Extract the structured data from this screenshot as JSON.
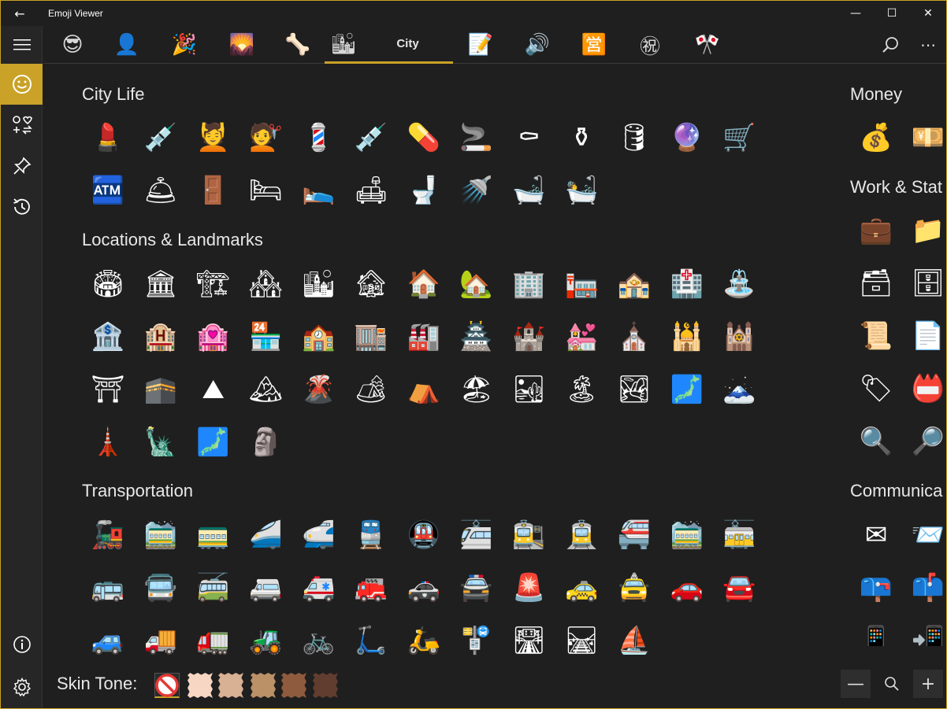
{
  "window": {
    "title": "Emoji Viewer",
    "back_glyph": "←",
    "minimize": "—",
    "maximize": "☐",
    "close": "✕"
  },
  "rail": {
    "menu_icon": "hamburger-icon",
    "items": [
      {
        "name": "smiley-icon",
        "glyph": "☺"
      },
      {
        "name": "symbols-icon",
        "glyph": "♡"
      },
      {
        "name": "pin-icon",
        "glyph": "📌"
      },
      {
        "name": "history-icon",
        "glyph": "⟲"
      }
    ],
    "info_glyph": "ⓘ",
    "settings_glyph": "⚙"
  },
  "categories": {
    "items": [
      "😎",
      "👤",
      "🎉",
      "🌄",
      "🦴",
      "🏙",
      "",
      "📝",
      "🔊",
      "🈺",
      "㊗",
      "🎌"
    ],
    "active_label": "City",
    "search_glyph": "⌕",
    "more_glyph": "⋯"
  },
  "sections": [
    {
      "title": "City Life",
      "emojis": [
        "💄",
        "💉",
        "💆",
        "💇",
        "💈",
        "💉",
        "💊",
        "🚬",
        "⚰",
        "⚱",
        "🛢",
        "🔮",
        "🛒",
        "🏧",
        "🛎",
        "🚪",
        "🛏",
        "🛌",
        "🛋",
        "🚽",
        "🚿",
        "🛁",
        "🛀"
      ]
    },
    {
      "title": "Locations & Landmarks",
      "emojis": [
        "🏟",
        "🏛",
        "🏗",
        "🏘",
        "🏙",
        "🏚",
        "🏠",
        "🏡",
        "🏢",
        "🏣",
        "🏤",
        "🏥",
        "⛲",
        "🏦",
        "🏨",
        "🏩",
        "🏪",
        "🏫",
        "🏬",
        "🏭",
        "🏯",
        "🏰",
        "💒",
        "⛪",
        "🕌",
        "🕍",
        "⛩",
        "🕋",
        "⛰",
        "🏔",
        "🌋",
        "🏕",
        "⛺",
        "🏖",
        "🏜",
        "🏝",
        "🏞",
        "🗾",
        "🗻",
        "🗼",
        "🗽",
        "🗾",
        "🗿"
      ]
    },
    {
      "title": "Transportation",
      "emojis": [
        "🚂",
        "🚞",
        "🚃",
        "🚄",
        "🚅",
        "🚆",
        "🚇",
        "🚈",
        "🚉",
        "🚊",
        "🚝",
        "🚞",
        "🚋",
        "🚌",
        "🚍",
        "🚎",
        "🚐",
        "🚑",
        "🚒",
        "🚓",
        "🚔",
        "🚨",
        "🚕",
        "🚖",
        "🚗",
        "🚘",
        "🚙",
        "🚚",
        "🚛",
        "🚜",
        "🚲",
        "🛴",
        "🛵",
        "🚏",
        "🛣",
        "🛤",
        "⛵"
      ]
    }
  ],
  "right_sections": [
    {
      "title": "Money",
      "emojis": [
        "💰",
        "💴"
      ]
    },
    {
      "title": "Work & Stat",
      "emojis": [
        "💼",
        "📁",
        "🗃",
        "🗄",
        "📜",
        "📄",
        "🏷",
        "📛",
        "🔍",
        "🔎"
      ]
    },
    {
      "title": "Communica",
      "emojis": [
        "✉",
        "📨",
        "📪",
        "📫",
        "📱",
        "📲"
      ]
    }
  ],
  "skin_tone": {
    "label": "Skin Tone:",
    "none_glyph": "🚫",
    "colors": [
      "#f7d7c4",
      "#d8b094",
      "#bb9167",
      "#8e5b3e",
      "#613d30"
    ]
  },
  "zoom": {
    "out": "—",
    "reset": "⌕",
    "in": "+"
  }
}
